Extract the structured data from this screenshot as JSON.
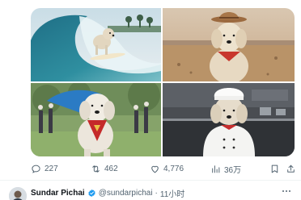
{
  "media": {
    "images": [
      {
        "alt": "Dog surfing a wave"
      },
      {
        "alt": "Dog wearing a cowboy hat in the desert"
      },
      {
        "alt": "Dog wearing a superhero cape"
      },
      {
        "alt": "Dog dressed as a chef in a kitchen"
      }
    ]
  },
  "actions": {
    "replies": "227",
    "retweets": "462",
    "likes": "4,776",
    "views": "36万"
  },
  "next_tweet": {
    "name": "Sundar Pichai",
    "handle": "@sundarpichai",
    "separator": "·",
    "time": "11小时"
  },
  "colors": {
    "verified": "#1d9bf0",
    "secondary_text": "#536471",
    "divider": "#eff3f4"
  },
  "icons": [
    "reply-icon",
    "retweet-icon",
    "like-icon",
    "views-icon",
    "bookmark-icon",
    "share-icon",
    "verified-badge-icon",
    "more-icon"
  ]
}
